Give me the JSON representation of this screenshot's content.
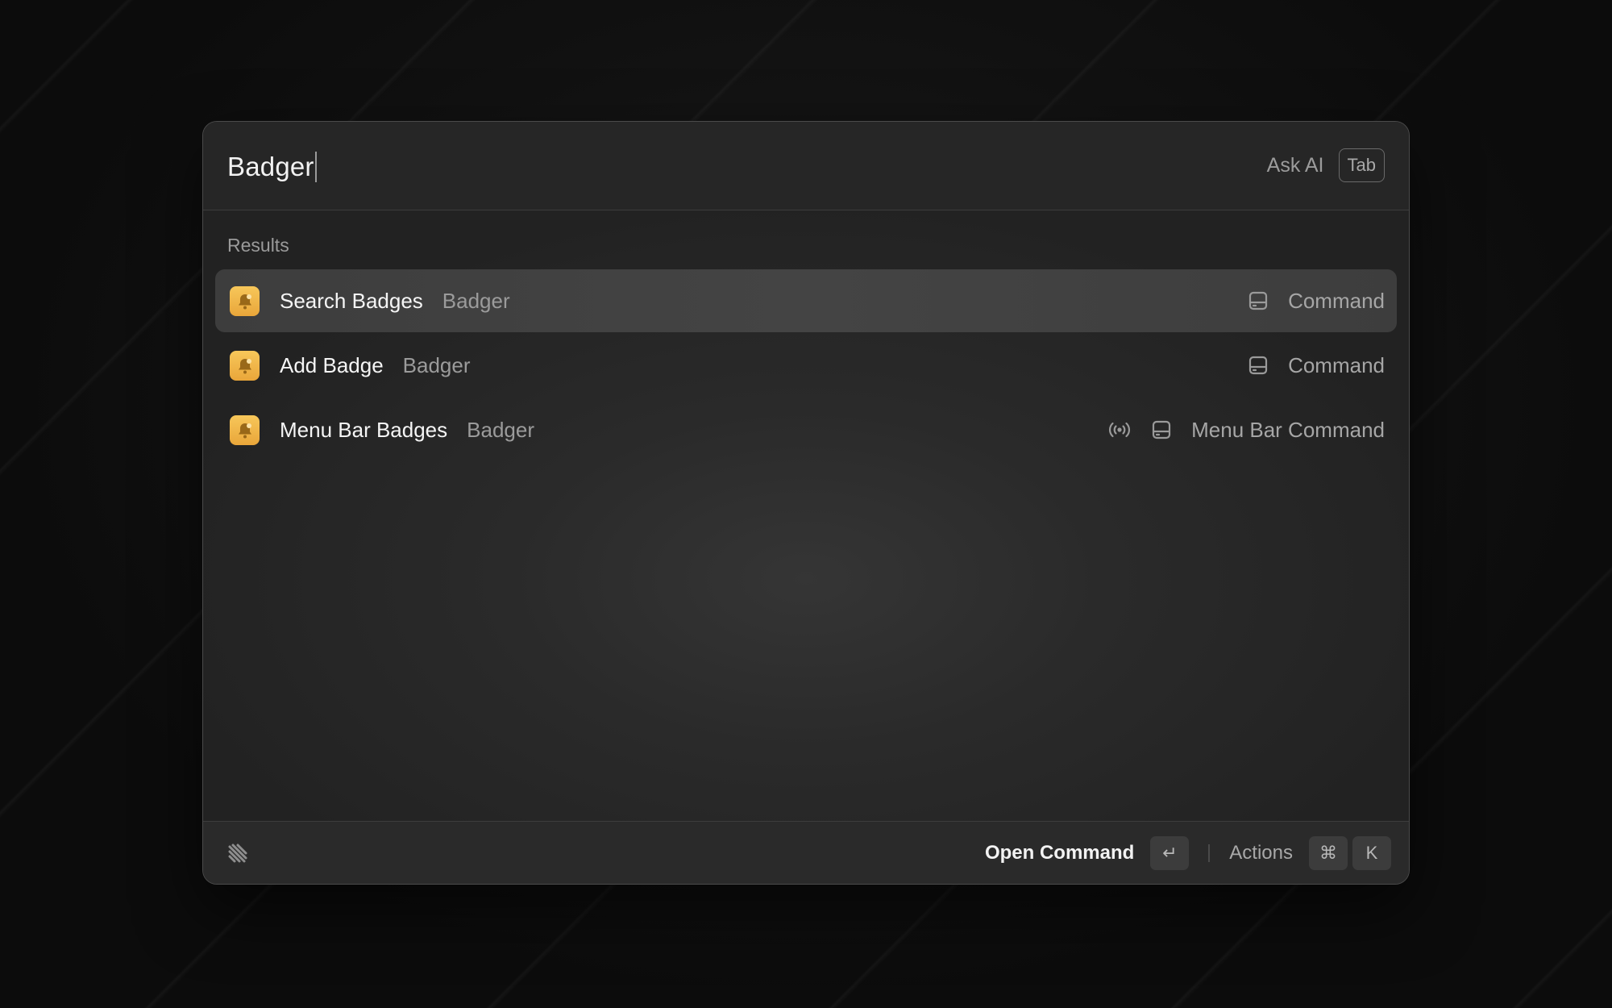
{
  "search": {
    "query": "Badger",
    "ask_ai_label": "Ask AI",
    "ask_ai_key": "Tab"
  },
  "results": {
    "section_label": "Results",
    "items": [
      {
        "title": "Search Badges",
        "subtitle": "Badger",
        "type": "Command",
        "icon": "bell-app-icon",
        "accessories": [
          "drive-icon"
        ],
        "selected": true
      },
      {
        "title": "Add Badge",
        "subtitle": "Badger",
        "type": "Command",
        "icon": "bell-app-icon",
        "accessories": [
          "drive-icon"
        ],
        "selected": false
      },
      {
        "title": "Menu Bar Badges",
        "subtitle": "Badger",
        "type": "Menu Bar Command",
        "icon": "bell-app-icon",
        "accessories": [
          "broadcast-icon",
          "drive-icon"
        ],
        "selected": false
      }
    ]
  },
  "footer": {
    "logo_icon": "raycast-logo-icon",
    "primary_action": "Open Command",
    "primary_key": "↵",
    "actions_label": "Actions",
    "actions_keys": [
      "⌘",
      "K"
    ]
  },
  "colors": {
    "background": "#0d0d0d",
    "window": "#2a2a2a",
    "selected_row": "#424242",
    "app_icon_accent": "#f0b548"
  }
}
